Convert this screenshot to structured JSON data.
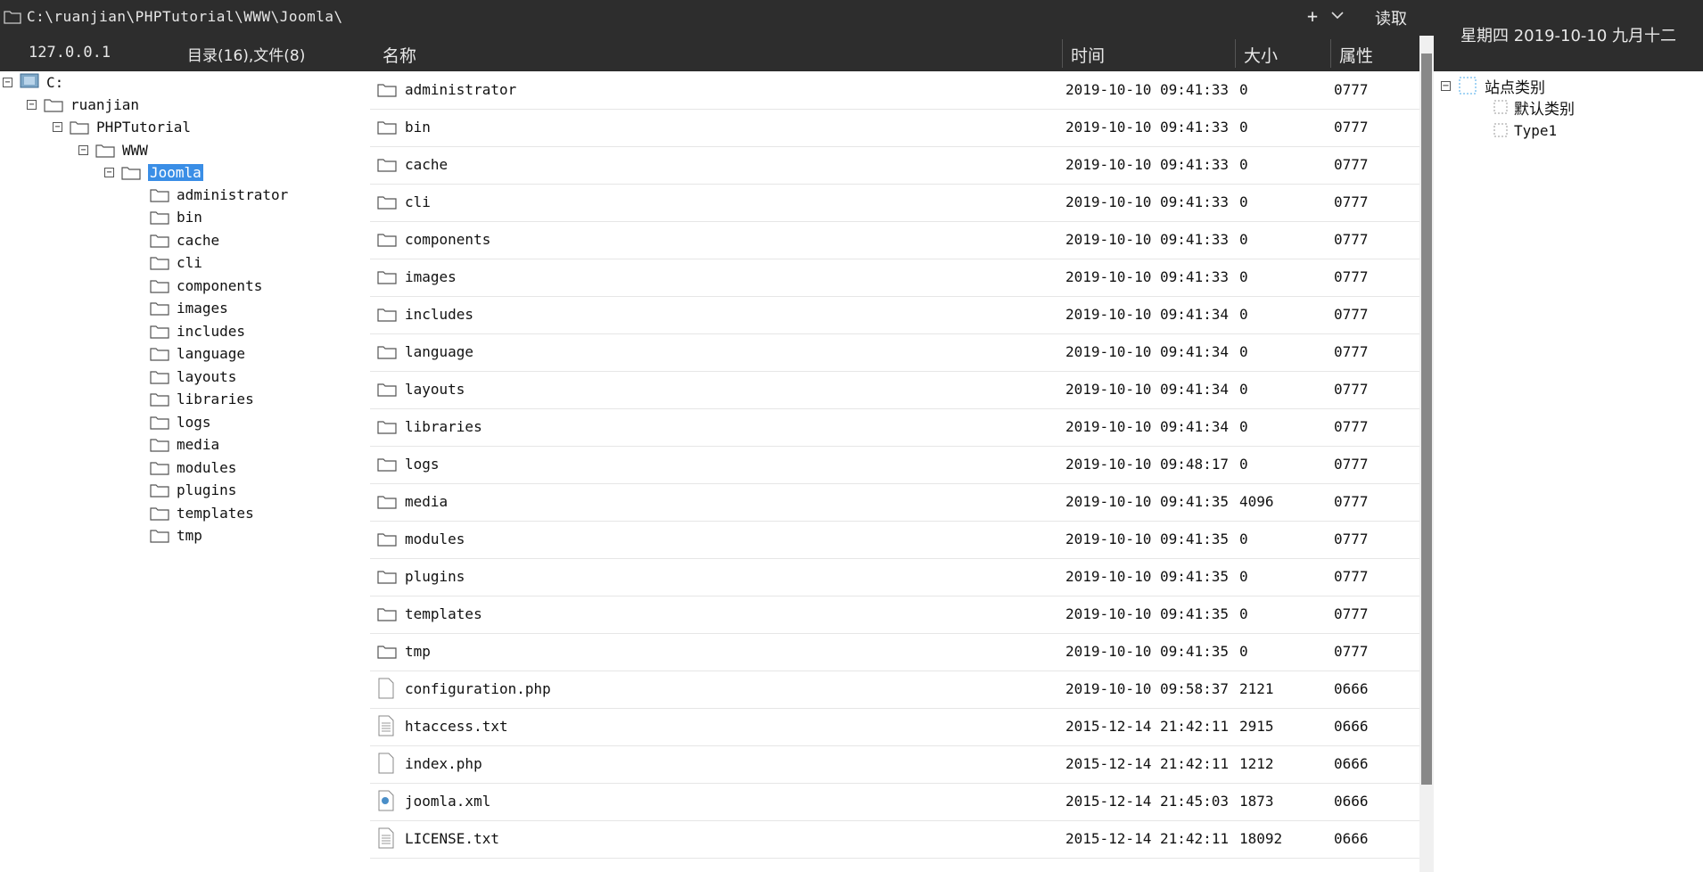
{
  "pathbar": {
    "path": "C:\\ruanjian\\PHPTutorial\\WWW\\Joomla\\",
    "add_label": "+",
    "read_label": "读取"
  },
  "infobar": {
    "host": "127.0.0.1",
    "counts": "目录(16),文件(8)"
  },
  "columns": {
    "name": "名称",
    "time": "时间",
    "size": "大小",
    "attr": "属性"
  },
  "datetime": "星期四 2019-10-10 九月十二",
  "site_tree": {
    "root": "站点类别",
    "children": [
      "默认类别",
      "Type1"
    ]
  },
  "tree": {
    "drive": "C:",
    "ruanjian": "ruanjian",
    "phptutorial": "PHPTutorial",
    "www": "WWW",
    "joomla": "Joomla",
    "children": [
      "administrator",
      "bin",
      "cache",
      "cli",
      "components",
      "images",
      "includes",
      "language",
      "layouts",
      "libraries",
      "logs",
      "media",
      "modules",
      "plugins",
      "templates",
      "tmp"
    ]
  },
  "files": [
    {
      "name": "administrator",
      "time": "2019-10-10 09:41:33",
      "size": "0",
      "attr": "0777",
      "type": "folder"
    },
    {
      "name": "bin",
      "time": "2019-10-10 09:41:33",
      "size": "0",
      "attr": "0777",
      "type": "folder"
    },
    {
      "name": "cache",
      "time": "2019-10-10 09:41:33",
      "size": "0",
      "attr": "0777",
      "type": "folder"
    },
    {
      "name": "cli",
      "time": "2019-10-10 09:41:33",
      "size": "0",
      "attr": "0777",
      "type": "folder"
    },
    {
      "name": "components",
      "time": "2019-10-10 09:41:33",
      "size": "0",
      "attr": "0777",
      "type": "folder"
    },
    {
      "name": "images",
      "time": "2019-10-10 09:41:33",
      "size": "0",
      "attr": "0777",
      "type": "folder"
    },
    {
      "name": "includes",
      "time": "2019-10-10 09:41:34",
      "size": "0",
      "attr": "0777",
      "type": "folder"
    },
    {
      "name": "language",
      "time": "2019-10-10 09:41:34",
      "size": "0",
      "attr": "0777",
      "type": "folder"
    },
    {
      "name": "layouts",
      "time": "2019-10-10 09:41:34",
      "size": "0",
      "attr": "0777",
      "type": "folder"
    },
    {
      "name": "libraries",
      "time": "2019-10-10 09:41:34",
      "size": "0",
      "attr": "0777",
      "type": "folder"
    },
    {
      "name": "logs",
      "time": "2019-10-10 09:48:17",
      "size": "0",
      "attr": "0777",
      "type": "folder"
    },
    {
      "name": "media",
      "time": "2019-10-10 09:41:35",
      "size": "4096",
      "attr": "0777",
      "type": "folder"
    },
    {
      "name": "modules",
      "time": "2019-10-10 09:41:35",
      "size": "0",
      "attr": "0777",
      "type": "folder"
    },
    {
      "name": "plugins",
      "time": "2019-10-10 09:41:35",
      "size": "0",
      "attr": "0777",
      "type": "folder"
    },
    {
      "name": "templates",
      "time": "2019-10-10 09:41:35",
      "size": "0",
      "attr": "0777",
      "type": "folder"
    },
    {
      "name": "tmp",
      "time": "2019-10-10 09:41:35",
      "size": "0",
      "attr": "0777",
      "type": "folder"
    },
    {
      "name": "configuration.php",
      "time": "2019-10-10 09:58:37",
      "size": "2121",
      "attr": "0666",
      "type": "file"
    },
    {
      "name": "htaccess.txt",
      "time": "2015-12-14 21:42:11",
      "size": "2915",
      "attr": "0666",
      "type": "text"
    },
    {
      "name": "index.php",
      "time": "2015-12-14 21:42:11",
      "size": "1212",
      "attr": "0666",
      "type": "file"
    },
    {
      "name": "joomla.xml",
      "time": "2015-12-14 21:45:03",
      "size": "1873",
      "attr": "0666",
      "type": "xml"
    },
    {
      "name": "LICENSE.txt",
      "time": "2015-12-14 21:42:11",
      "size": "18092",
      "attr": "0666",
      "type": "text"
    }
  ],
  "colors": {
    "toolbar": "#2d2d2d",
    "selection": "#3a8ee6"
  }
}
